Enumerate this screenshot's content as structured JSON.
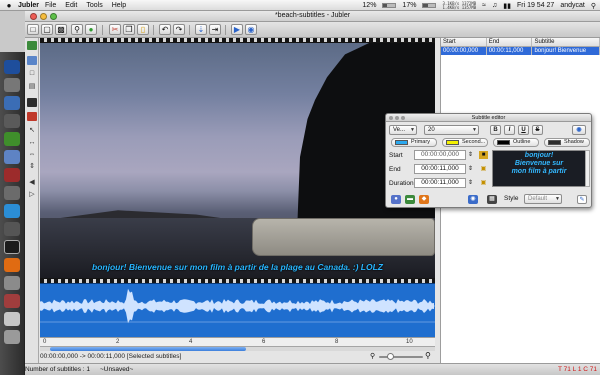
{
  "menubar": {
    "app_name": "Jubler",
    "menus": [
      "File",
      "Edit",
      "Tools",
      "Help"
    ],
    "cpu1": "12%",
    "cpu2": "17%",
    "net_stats": "3.1KB/s 1372MB\n1.4KB/s 1357MB",
    "clock": "Fri 19 54 27",
    "user": "andycat"
  },
  "window": {
    "title": "*beach-subtitles - Jubler"
  },
  "movie": {
    "subtitle_text": "bonjour! Bienvenue sur mon film à partir de la plage au Canada. :) LOLZ"
  },
  "timeline": {
    "ticks": [
      "0",
      "2",
      "4",
      "6",
      "8",
      "10"
    ],
    "selection_text": "00:00:00,000 -> 00:00:11,000 [Selected subtitles]"
  },
  "subtitle_list": {
    "columns": [
      "Start",
      "End",
      "Subtitle"
    ],
    "rows": [
      {
        "start": "00:00:00,000",
        "end": "00:00:11,000",
        "text": "bonjour! Bienvenue"
      }
    ]
  },
  "status_bar": {
    "count_text": "Number of subtitles : 1",
    "unsaved_text": "~Unsaved~",
    "caret_text": "T 71 L 1 C 71"
  },
  "editor": {
    "title": "Subtitle editor",
    "font_value": "Ve...",
    "size_value": "20",
    "bold": "B",
    "italic": "I",
    "underline": "U",
    "strike": "S",
    "colors": {
      "primary_label": "Primary",
      "secondary_label": "Second...",
      "outline_label": "Outline",
      "shadow_label": "Shadow",
      "primary": "#2ba8ee",
      "secondary": "#f3f000",
      "outline": "#000000",
      "shadow": "#2c2c2c"
    },
    "start_label": "Start",
    "end_label": "End",
    "duration_label": "Duration",
    "start_value": "00:00:00,000",
    "end_value": "00:00:11,000",
    "duration_value": "00:00:11,000",
    "text": "bonjour!\nBienvenue sur\nmon film à partir",
    "style_label": "Style",
    "style_value": "Default"
  }
}
